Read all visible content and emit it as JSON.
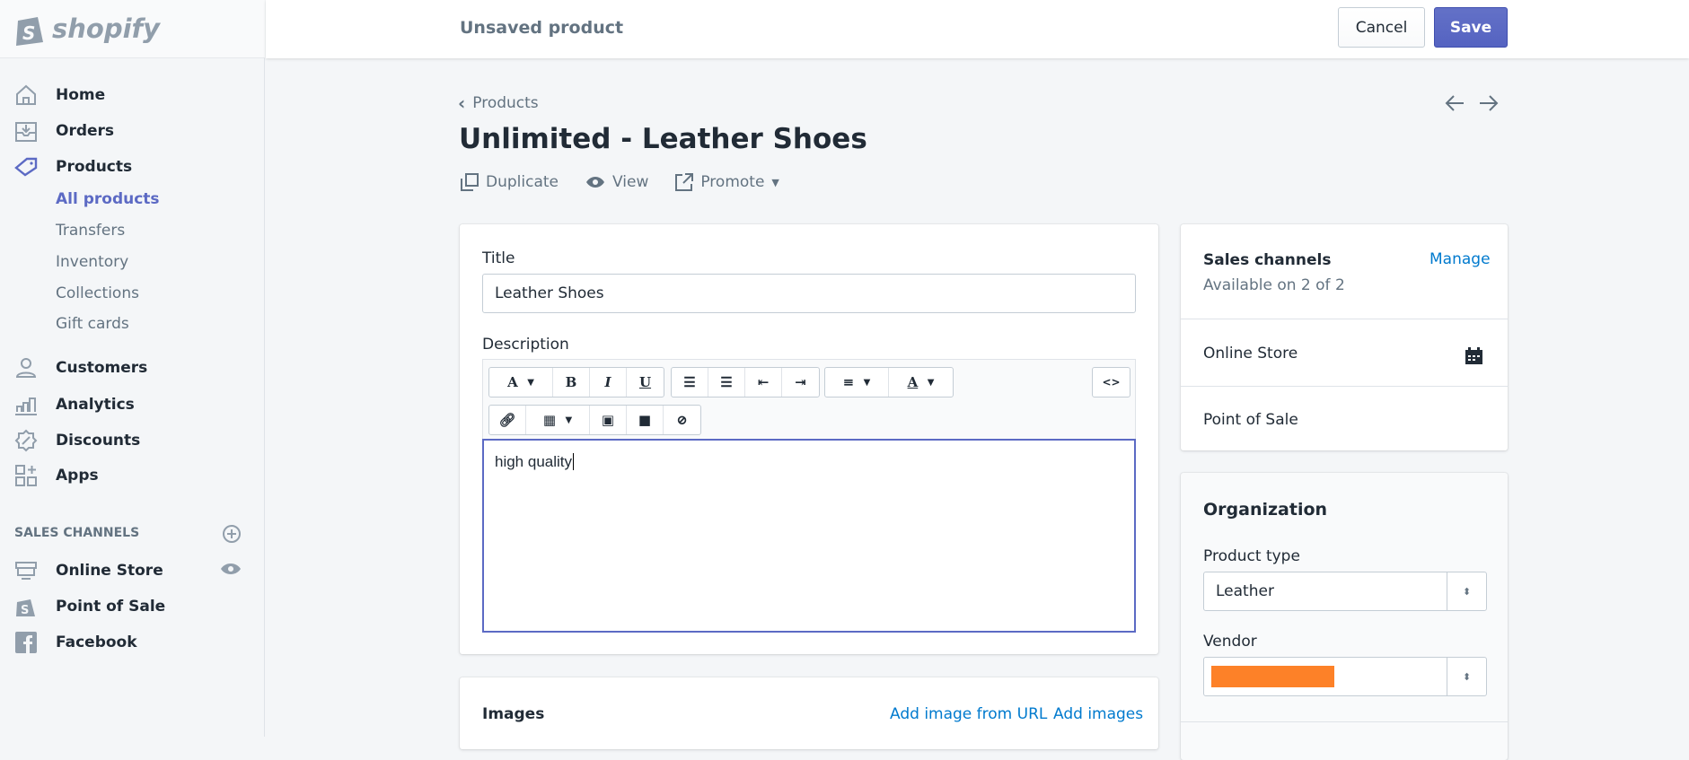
{
  "brand": "shopify",
  "sidebar": {
    "items": [
      {
        "label": "Home",
        "icon": "home-icon"
      },
      {
        "label": "Orders",
        "icon": "orders-icon"
      },
      {
        "label": "Products",
        "icon": "tag-icon"
      },
      {
        "label": "Customers",
        "icon": "customer-icon"
      },
      {
        "label": "Analytics",
        "icon": "analytics-icon"
      },
      {
        "label": "Discounts",
        "icon": "discount-icon"
      },
      {
        "label": "Apps",
        "icon": "apps-icon"
      }
    ],
    "product_subitems": [
      "All products",
      "Transfers",
      "Inventory",
      "Collections",
      "Gift cards"
    ],
    "sales_channels_heading": "SALES CHANNELS",
    "channels": [
      {
        "label": "Online Store"
      },
      {
        "label": "Point of Sale"
      },
      {
        "label": "Facebook"
      }
    ]
  },
  "topbar": {
    "title": "Unsaved product",
    "cancel": "Cancel",
    "save": "Save"
  },
  "page": {
    "breadcrumb": "Products",
    "title": "Unlimited - Leather Shoes",
    "actions": {
      "duplicate": "Duplicate",
      "view": "View",
      "promote": "Promote"
    }
  },
  "form": {
    "title_label": "Title",
    "title_value": "Leather Shoes",
    "description_label": "Description",
    "description_value": "high quality",
    "code_label": "<>"
  },
  "images": {
    "heading": "Images",
    "add_url": "Add image from URL",
    "add": "Add images"
  },
  "sales_channels": {
    "heading": "Sales channels",
    "subtitle": "Available on 2 of 2",
    "manage": "Manage",
    "channels": [
      "Online Store",
      "Point of Sale"
    ]
  },
  "organization": {
    "heading": "Organization",
    "product_type_label": "Product type",
    "product_type_value": "Leather",
    "vendor_label": "Vendor",
    "vendor_redaction_color": "#fd8128"
  },
  "colors": {
    "accent": "#5c6ac4",
    "link": "#007ace"
  }
}
